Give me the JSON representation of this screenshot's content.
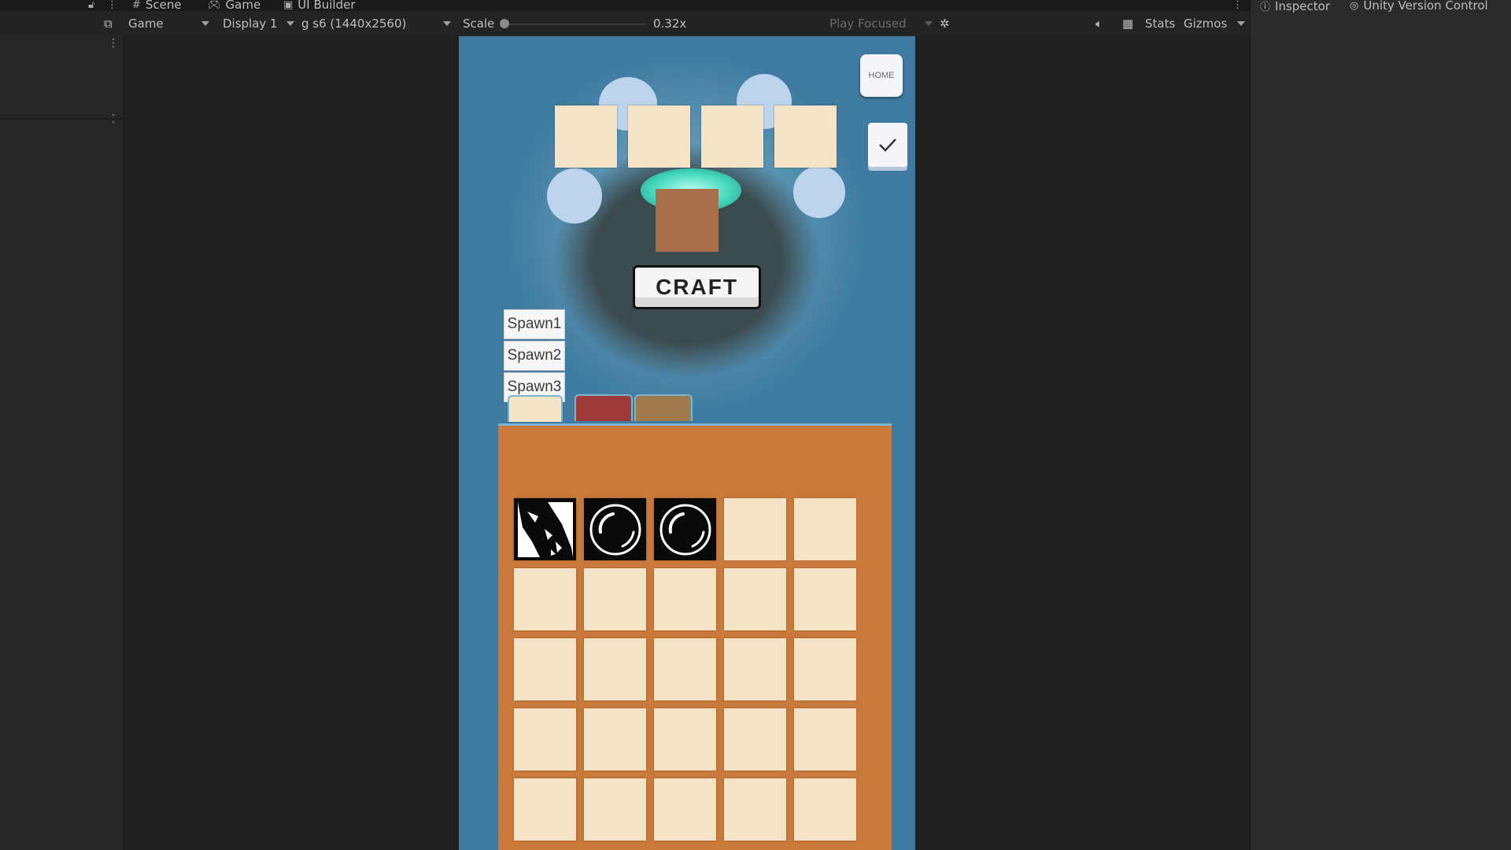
{
  "editor_tabs": {
    "scene": "Scene",
    "game": "Game",
    "ui_builder": "UI Builder"
  },
  "toolbar": {
    "view_mode": "Game",
    "display": "Display 1",
    "resolution": "g s6 (1440x2560)",
    "scale_label": "Scale",
    "scale_value": "0.32x",
    "play_mode": "Play Focused",
    "stats": "Stats",
    "gizmos": "Gizmos"
  },
  "right_panel": {
    "inspector": "Inspector",
    "version_control": "Unity Version Control"
  },
  "game": {
    "home_label": "HOME",
    "craft_label": "CRAFT",
    "spawn_buttons": [
      "Spawn1",
      "Spawn2",
      "Spawn3"
    ],
    "inventory_tabs": [
      {
        "color": "#f4e3c6"
      },
      {
        "color": "#9e3a3a"
      },
      {
        "color": "#a07a4a"
      }
    ],
    "inventory_items": [
      "crystal-shard-icon",
      "bubble-orb-icon",
      "bubble-orb-icon"
    ],
    "colors": {
      "slot": "#f4e3c6",
      "inventory_panel": "#c8793b",
      "result_slot": "#a8704a"
    }
  }
}
